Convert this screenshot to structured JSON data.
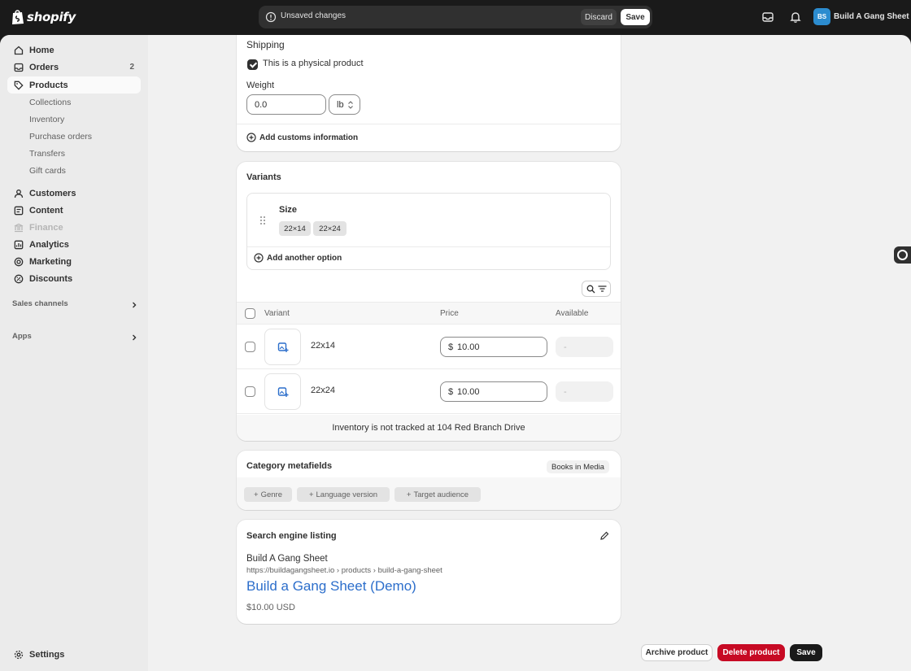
{
  "topbar": {
    "logo_text": "shopify",
    "unsaved_text": "Unsaved changes",
    "discard_label": "Discard",
    "save_label": "Save",
    "avatar_initials": "BS",
    "store_name": "Build A Gang Sheet"
  },
  "sidebar": {
    "items": [
      {
        "label": "Home",
        "icon": "home-icon"
      },
      {
        "label": "Orders",
        "icon": "inbox-icon",
        "badge": "2"
      },
      {
        "label": "Products",
        "icon": "tag-icon"
      },
      {
        "label": "Collections"
      },
      {
        "label": "Inventory"
      },
      {
        "label": "Purchase orders"
      },
      {
        "label": "Transfers"
      },
      {
        "label": "Gift cards"
      },
      {
        "label": "Customers",
        "icon": "person-icon"
      },
      {
        "label": "Content",
        "icon": "content-icon"
      },
      {
        "label": "Finance",
        "icon": "bank-icon"
      },
      {
        "label": "Analytics",
        "icon": "chart-icon"
      },
      {
        "label": "Marketing",
        "icon": "target-icon"
      },
      {
        "label": "Discounts",
        "icon": "discount-icon"
      }
    ],
    "sales_channels_label": "Sales channels",
    "apps_label": "Apps",
    "settings_label": "Settings"
  },
  "shipping": {
    "title": "Shipping",
    "physical_label": "This is a physical product",
    "physical_checked": true,
    "weight_label": "Weight",
    "weight_value": "0.0",
    "weight_unit": "lb",
    "customs_label": "Add customs information"
  },
  "variants": {
    "title": "Variants",
    "option_name": "Size",
    "option_values": [
      "22×14",
      "22×24"
    ],
    "add_option_label": "Add another option",
    "columns": {
      "variant": "Variant",
      "price": "Price",
      "available": "Available"
    },
    "rows": [
      {
        "name": "22x14",
        "currency": "$",
        "price": "10.00",
        "available": "-"
      },
      {
        "name": "22x24",
        "currency": "$",
        "price": "10.00",
        "available": "-"
      }
    ],
    "inventory_note": "Inventory is not tracked at 104 Red Branch Drive"
  },
  "metafields": {
    "title": "Category metafields",
    "category_badge": "Books in Media",
    "chips": [
      "Genre",
      "Language version",
      "Target audience"
    ]
  },
  "seo": {
    "title": "Search engine listing",
    "store_name": "Build A Gang Sheet",
    "url": "https://buildagangsheet.io › products › build-a-gang-sheet",
    "page_title": "Build a Gang Sheet (Demo)",
    "price": "$10.00 USD",
    "link_color": "#2c6ecb"
  },
  "footer": {
    "archive_label": "Archive product",
    "delete_label": "Delete product",
    "save_label": "Save"
  },
  "colors": {
    "topbar": "#1a1a1a",
    "delete": "#c70a24",
    "avatar": "#2c8ccf"
  }
}
